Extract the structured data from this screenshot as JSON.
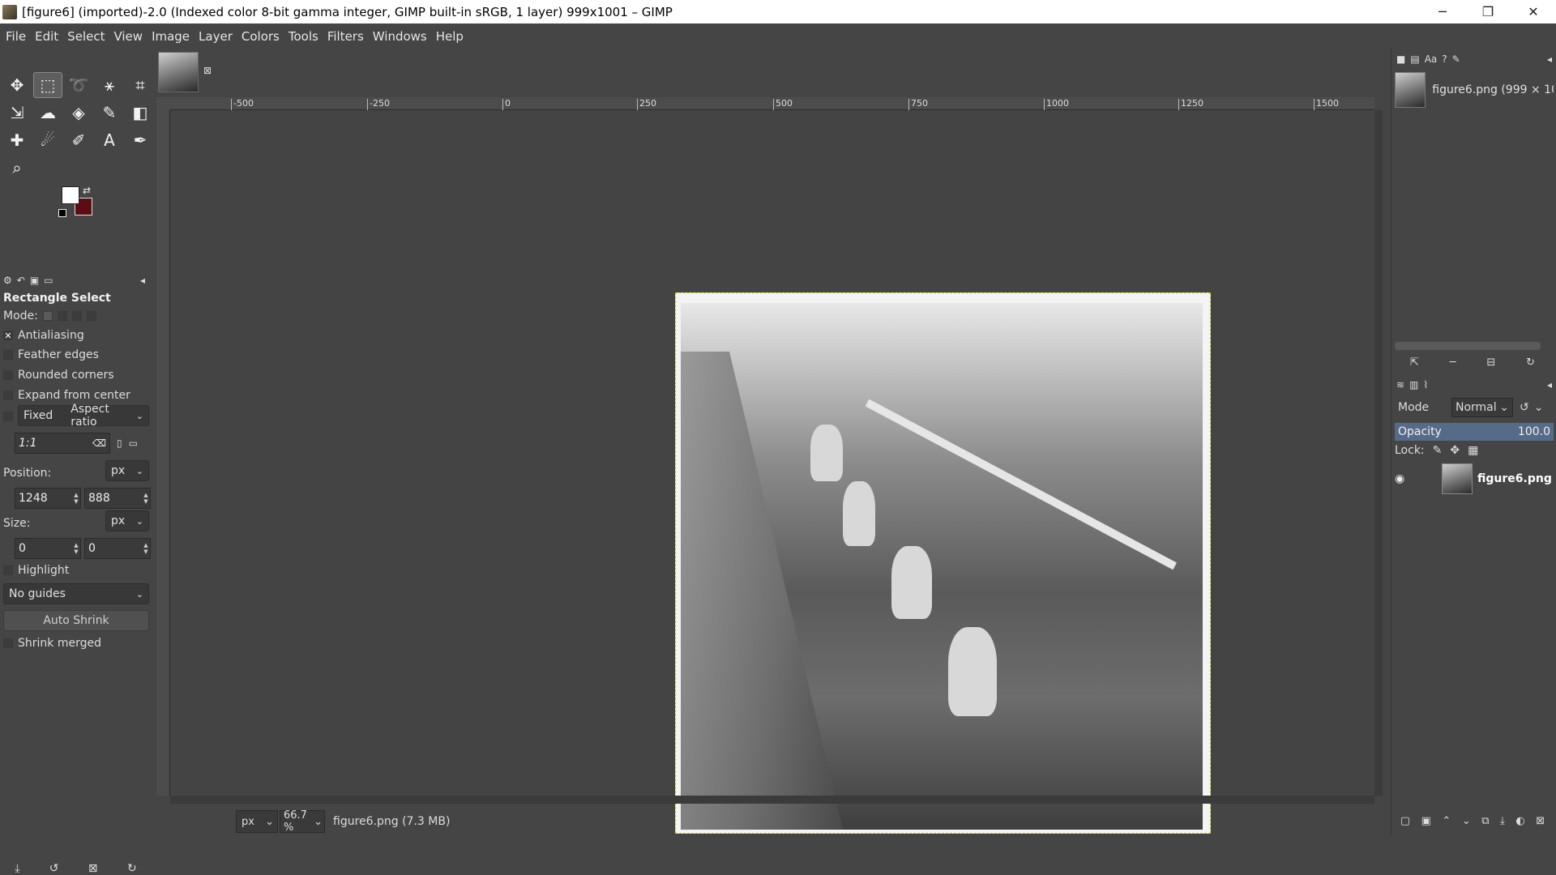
{
  "window": {
    "title": "[figure6] (imported)-2.0 (Indexed color 8-bit gamma integer, GIMP built-in sRGB, 1 layer) 999x1001 – GIMP",
    "minimize": "─",
    "maximize": "❐",
    "close": "✕"
  },
  "menu": [
    "File",
    "Edit",
    "Select",
    "View",
    "Image",
    "Layer",
    "Colors",
    "Tools",
    "Filters",
    "Windows",
    "Help"
  ],
  "tool_options": {
    "title": "Rectangle Select",
    "mode_label": "Mode:",
    "antialiasing": "Antialiasing",
    "feather_edges": "Feather edges",
    "rounded_corners": "Rounded corners",
    "expand_from_center": "Expand from center",
    "fixed_label": "Fixed",
    "fixed_value": "Aspect ratio",
    "ratio_value": "1:1",
    "position_label": "Position:",
    "position_unit": "px",
    "position_x": "1248",
    "position_y": "888",
    "size_label": "Size:",
    "size_unit": "px",
    "size_w": "0",
    "size_h": "0",
    "highlight": "Highlight",
    "guides": "No guides",
    "auto_shrink": "Auto Shrink",
    "shrink_merged": "Shrink merged"
  },
  "ruler_h_labels": [
    "-500",
    "-250",
    "0",
    "250",
    "500",
    "750",
    "1000",
    "1250",
    "1500"
  ],
  "status": {
    "unit": "px",
    "zoom": "66.7 %",
    "file": "figure6.png (7.3 MB)"
  },
  "images_panel": {
    "item_label": "figure6.png (999 × 1001"
  },
  "layers_panel": {
    "mode_label": "Mode",
    "mode_value": "Normal",
    "opacity_label": "Opacity",
    "opacity_value": "100.0",
    "lock_label": "Lock:",
    "layer_name": "figure6.png"
  }
}
